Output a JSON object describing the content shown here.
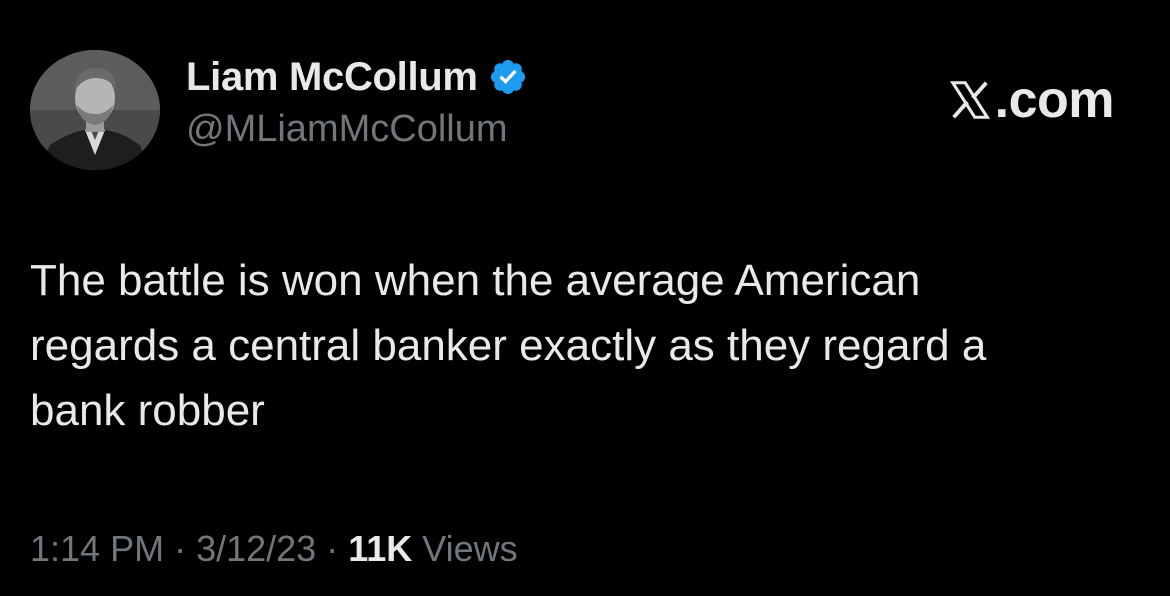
{
  "author": {
    "name": "Liam McCollum",
    "handle": "@MLiamMcCollum",
    "verified": true,
    "verified_color": "#1d9bf0"
  },
  "site": {
    "domain": ".com",
    "logo_icon": "x-logo-icon"
  },
  "tweet": {
    "lines": [
      "The battle is won when the average American",
      "regards a central banker exactly as they regard a",
      "bank robber"
    ]
  },
  "meta": {
    "time": "1:14 PM",
    "separator": "·",
    "date": "3/12/23",
    "views_count": "11K",
    "views_label": "Views"
  },
  "colors": {
    "background": "#000000",
    "primary_text": "#e7e9ea",
    "secondary_text": "#71767b"
  }
}
